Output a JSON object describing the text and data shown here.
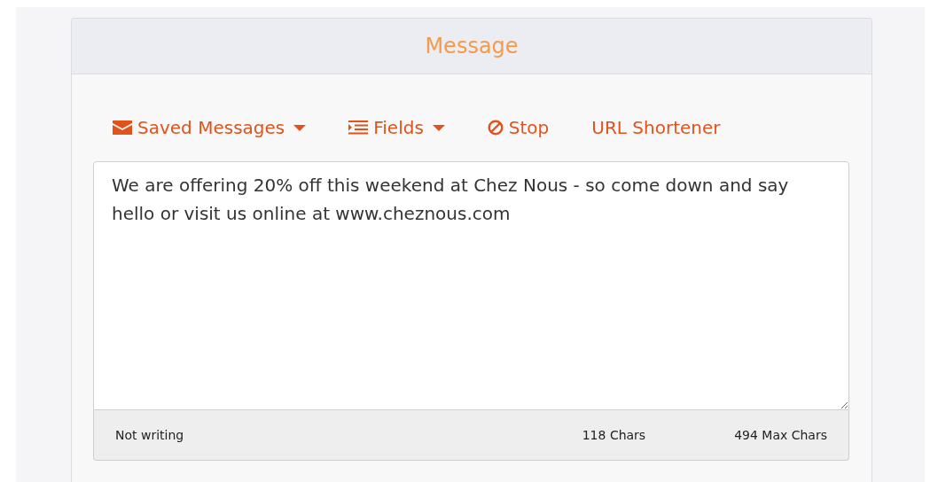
{
  "panel": {
    "title": "Message"
  },
  "toolbar": [
    {
      "label": "Saved Messages",
      "kind": "envelope",
      "dropdown": true
    },
    {
      "label": "Fields",
      "kind": "list",
      "dropdown": true
    },
    {
      "label": "Stop",
      "kind": "ban",
      "dropdown": false
    },
    {
      "label": "URL Shortener",
      "kind": "plain",
      "dropdown": false
    }
  ],
  "message": {
    "value": "We are offering 20% off this weekend at Chez Nous - so come down and say hello or visit us online at www.cheznous.com"
  },
  "status_bar": {
    "status": "Not writing",
    "count": "118 Chars",
    "max": "494 Max Chars"
  }
}
